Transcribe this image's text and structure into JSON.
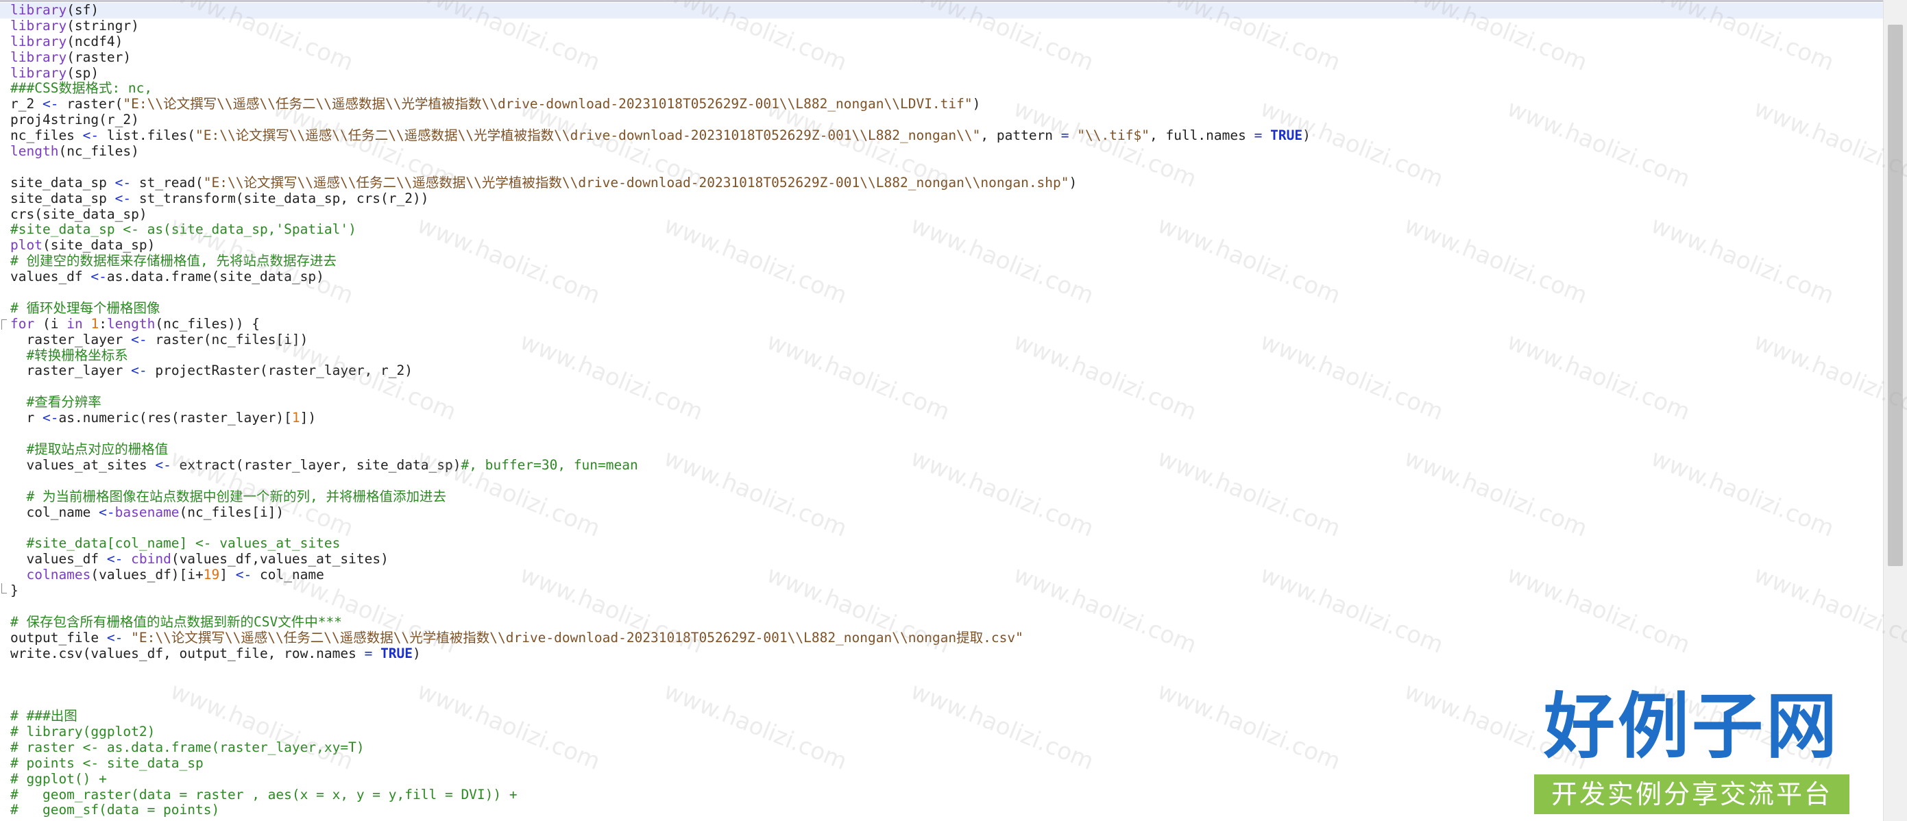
{
  "editor": {
    "lines": [
      {
        "type": "code",
        "tokens": [
          {
            "c": "kw",
            "t": "library"
          },
          {
            "t": "(sf)"
          }
        ]
      },
      {
        "type": "code",
        "tokens": [
          {
            "c": "kw",
            "t": "library"
          },
          {
            "t": "(stringr)"
          }
        ]
      },
      {
        "type": "code",
        "tokens": [
          {
            "c": "kw",
            "t": "library"
          },
          {
            "t": "(ncdf4)"
          }
        ]
      },
      {
        "type": "code",
        "tokens": [
          {
            "c": "kw",
            "t": "library"
          },
          {
            "t": "(raster)"
          }
        ]
      },
      {
        "type": "code",
        "tokens": [
          {
            "c": "kw",
            "t": "library"
          },
          {
            "t": "(sp)"
          }
        ]
      },
      {
        "type": "code",
        "tokens": [
          {
            "c": "com",
            "t": "###CSS数据格式: nc,"
          }
        ]
      },
      {
        "type": "code",
        "tokens": [
          {
            "t": "r_2 "
          },
          {
            "c": "op",
            "t": "<-"
          },
          {
            "t": " raster("
          },
          {
            "c": "str",
            "t": "\"E:\\\\论文撰写\\\\遥感\\\\任务二\\\\遥感数据\\\\光学植被指数\\\\drive-download-20231018T052629Z-001\\\\L882_nongan\\\\LDVI.tif\""
          },
          {
            "t": ")"
          }
        ]
      },
      {
        "type": "code",
        "tokens": [
          {
            "t": "proj4string(r_2)"
          }
        ]
      },
      {
        "type": "code",
        "tokens": [
          {
            "t": "nc_files "
          },
          {
            "c": "op",
            "t": "<-"
          },
          {
            "t": " list.files("
          },
          {
            "c": "str",
            "t": "\"E:\\\\论文撰写\\\\遥感\\\\任务二\\\\遥感数据\\\\光学植被指数\\\\drive-download-20231018T052629Z-001\\\\L882_nongan\\\\\""
          },
          {
            "t": ", pattern "
          },
          {
            "c": "op",
            "t": "="
          },
          {
            "t": " "
          },
          {
            "c": "str",
            "t": "\"\\\\.tif$\""
          },
          {
            "t": ", full.names "
          },
          {
            "c": "op",
            "t": "="
          },
          {
            "t": " "
          },
          {
            "c": "bool",
            "t": "TRUE"
          },
          {
            "t": ")"
          }
        ]
      },
      {
        "type": "code",
        "tokens": [
          {
            "c": "kw",
            "t": "length"
          },
          {
            "t": "(nc_files)"
          }
        ]
      },
      {
        "type": "blank",
        "tokens": []
      },
      {
        "type": "code",
        "tokens": [
          {
            "t": "site_data_sp "
          },
          {
            "c": "op",
            "t": "<-"
          },
          {
            "t": " st_read("
          },
          {
            "c": "str",
            "t": "\"E:\\\\论文撰写\\\\遥感\\\\任务二\\\\遥感数据\\\\光学植被指数\\\\drive-download-20231018T052629Z-001\\\\L882_nongan\\\\nongan.shp\""
          },
          {
            "t": ")"
          }
        ]
      },
      {
        "type": "code",
        "tokens": [
          {
            "t": "site_data_sp "
          },
          {
            "c": "op",
            "t": "<-"
          },
          {
            "t": " st_transform(site_data_sp, crs(r_2))"
          }
        ]
      },
      {
        "type": "code",
        "tokens": [
          {
            "t": "crs(site_data_sp)"
          }
        ]
      },
      {
        "type": "code",
        "tokens": [
          {
            "c": "com",
            "t": "#site_data_sp <- as(site_data_sp,'Spatial')"
          }
        ]
      },
      {
        "type": "code",
        "tokens": [
          {
            "c": "kw",
            "t": "plot"
          },
          {
            "t": "(site_data_sp)"
          }
        ]
      },
      {
        "type": "code",
        "tokens": [
          {
            "c": "com",
            "t": "# 创建空的数据框来存储栅格值, 先将站点数据存进去"
          }
        ]
      },
      {
        "type": "code",
        "tokens": [
          {
            "t": "values_df "
          },
          {
            "c": "op",
            "t": "<-"
          },
          {
            "t": "as.data.frame(site_data_sp)"
          }
        ]
      },
      {
        "type": "blank",
        "tokens": []
      },
      {
        "type": "code",
        "tokens": [
          {
            "c": "com",
            "t": "# 循环处理每个栅格图像"
          }
        ]
      },
      {
        "type": "code",
        "fold": "start",
        "tokens": [
          {
            "c": "kw",
            "t": "for"
          },
          {
            "t": " (i "
          },
          {
            "c": "kw",
            "t": "in"
          },
          {
            "t": " "
          },
          {
            "c": "num",
            "t": "1"
          },
          {
            "t": ":"
          },
          {
            "c": "kw",
            "t": "length"
          },
          {
            "t": "(nc_files)) {"
          }
        ]
      },
      {
        "type": "code",
        "tokens": [
          {
            "t": "  raster_layer "
          },
          {
            "c": "op",
            "t": "<-"
          },
          {
            "t": " raster(nc_files[i])"
          }
        ]
      },
      {
        "type": "code",
        "tokens": [
          {
            "c": "com",
            "t": "  #转换栅格坐标系"
          }
        ]
      },
      {
        "type": "code",
        "tokens": [
          {
            "t": "  raster_layer "
          },
          {
            "c": "op",
            "t": "<-"
          },
          {
            "t": " projectRaster(raster_layer, r_2)"
          }
        ]
      },
      {
        "type": "blank",
        "tokens": []
      },
      {
        "type": "code",
        "tokens": [
          {
            "c": "com",
            "t": "  #查看分辨率"
          }
        ]
      },
      {
        "type": "code",
        "tokens": [
          {
            "t": "  r "
          },
          {
            "c": "op",
            "t": "<-"
          },
          {
            "t": "as.numeric(res(raster_layer)["
          },
          {
            "c": "num",
            "t": "1"
          },
          {
            "t": "])"
          }
        ]
      },
      {
        "type": "blank",
        "tokens": []
      },
      {
        "type": "code",
        "tokens": [
          {
            "c": "com",
            "t": "  #提取站点对应的栅格值"
          }
        ]
      },
      {
        "type": "code",
        "tokens": [
          {
            "t": "  values_at_sites "
          },
          {
            "c": "op",
            "t": "<-"
          },
          {
            "t": " extract(raster_layer, site_data_sp)"
          },
          {
            "c": "com",
            "t": "#, buffer=30, fun=mean"
          }
        ]
      },
      {
        "type": "blank",
        "tokens": []
      },
      {
        "type": "code",
        "tokens": [
          {
            "c": "com",
            "t": "  # 为当前栅格图像在站点数据中创建一个新的列, 并将栅格值添加进去"
          }
        ]
      },
      {
        "type": "code",
        "tokens": [
          {
            "t": "  col_name "
          },
          {
            "c": "op",
            "t": "<-"
          },
          {
            "c": "kw",
            "t": "basename"
          },
          {
            "t": "(nc_files[i])"
          }
        ]
      },
      {
        "type": "blank",
        "tokens": []
      },
      {
        "type": "code",
        "tokens": [
          {
            "c": "com",
            "t": "  #site_data[col_name] <- values_at_sites"
          }
        ]
      },
      {
        "type": "code",
        "tokens": [
          {
            "t": "  values_df "
          },
          {
            "c": "op",
            "t": "<-"
          },
          {
            "t": " "
          },
          {
            "c": "kw",
            "t": "cbind"
          },
          {
            "t": "(values_df,values_at_sites)"
          }
        ]
      },
      {
        "type": "code",
        "tokens": [
          {
            "t": "  "
          },
          {
            "c": "kw",
            "t": "colnames"
          },
          {
            "t": "(values_df)[i+"
          },
          {
            "c": "num",
            "t": "19"
          },
          {
            "t": "] "
          },
          {
            "c": "op",
            "t": "<-"
          },
          {
            "t": " col_name"
          }
        ]
      },
      {
        "type": "code",
        "fold": "end",
        "tokens": [
          {
            "t": "}"
          }
        ]
      },
      {
        "type": "blank",
        "tokens": []
      },
      {
        "type": "code",
        "tokens": [
          {
            "c": "com",
            "t": "# 保存包含所有栅格值的站点数据到新的CSV文件中***"
          }
        ]
      },
      {
        "type": "code",
        "tokens": [
          {
            "t": "output_file "
          },
          {
            "c": "op",
            "t": "<-"
          },
          {
            "t": " "
          },
          {
            "c": "str",
            "t": "\"E:\\\\论文撰写\\\\遥感\\\\任务二\\\\遥感数据\\\\光学植被指数\\\\drive-download-20231018T052629Z-001\\\\L882_nongan\\\\nongan提取.csv\""
          }
        ]
      },
      {
        "type": "code",
        "tokens": [
          {
            "t": "write.csv(values_df, output_file, row.names "
          },
          {
            "c": "op",
            "t": "="
          },
          {
            "t": " "
          },
          {
            "c": "bool",
            "t": "TRUE"
          },
          {
            "t": ")"
          }
        ]
      },
      {
        "type": "blank",
        "tokens": []
      },
      {
        "type": "blank",
        "tokens": []
      },
      {
        "type": "blank",
        "tokens": []
      },
      {
        "type": "code",
        "tokens": [
          {
            "c": "com",
            "t": "# ###出图"
          }
        ]
      },
      {
        "type": "code",
        "tokens": [
          {
            "c": "com",
            "t": "# library(ggplot2)"
          }
        ]
      },
      {
        "type": "code",
        "tokens": [
          {
            "c": "com",
            "t": "# raster <- as.data.frame(raster_layer,xy=T)"
          }
        ]
      },
      {
        "type": "code",
        "tokens": [
          {
            "c": "com",
            "t": "# points <- site_data_sp"
          }
        ]
      },
      {
        "type": "code",
        "tokens": [
          {
            "c": "com",
            "t": "# ggplot() +"
          }
        ]
      },
      {
        "type": "code",
        "tokens": [
          {
            "c": "com",
            "t": "#   geom_raster(data = raster , aes(x = x, y = y,fill = DVI)) +"
          }
        ]
      },
      {
        "type": "code",
        "tokens": [
          {
            "c": "com",
            "t": "#   geom_sf(data = points)"
          }
        ]
      }
    ]
  },
  "watermark": {
    "text": "www.haolizi.com"
  },
  "brand": {
    "title": "好例子网",
    "subtitle": "开发实例分享交流平台"
  }
}
